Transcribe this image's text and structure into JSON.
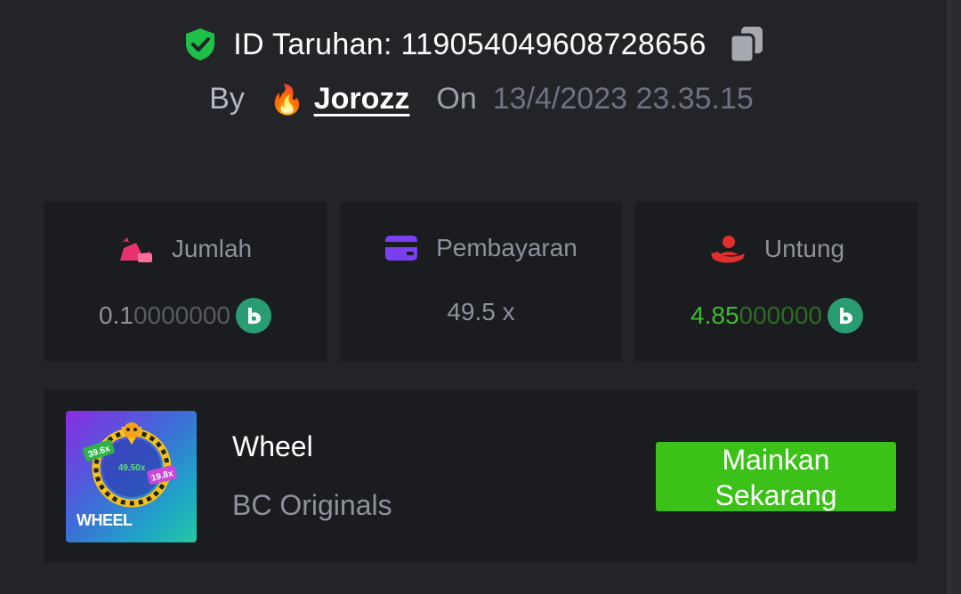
{
  "bet": {
    "id_label": "ID Taruhan: 119054049608728656",
    "by_label": "By",
    "user": "Jorozz",
    "on_label": "On",
    "date": "13/4/2023 23.35.15"
  },
  "stats": [
    {
      "label": "Jumlah",
      "value_main": "0.1",
      "value_dim": "0000000",
      "icon": "bet-amount-icon"
    },
    {
      "label": "Pembayaran",
      "value": "49.5 x",
      "icon": "card-icon"
    },
    {
      "label": "Untung",
      "value_main": "4.85",
      "value_dim": "000000",
      "icon": "profit-hand-icon"
    }
  ],
  "game": {
    "name": "Wheel",
    "provider": "BC Originals",
    "play_line1": "Mainkan",
    "play_line2": "Sekarang",
    "thumb": {
      "title": "WHEEL",
      "m1": "39.6x",
      "m2": "49.50x",
      "m3": "19.8x"
    }
  },
  "colors": {
    "background": "#232427",
    "card": "#1b1c1f",
    "accent_green": "#3bc117",
    "profit_green": "#3dbb2c",
    "coin": "#2a9c72"
  }
}
